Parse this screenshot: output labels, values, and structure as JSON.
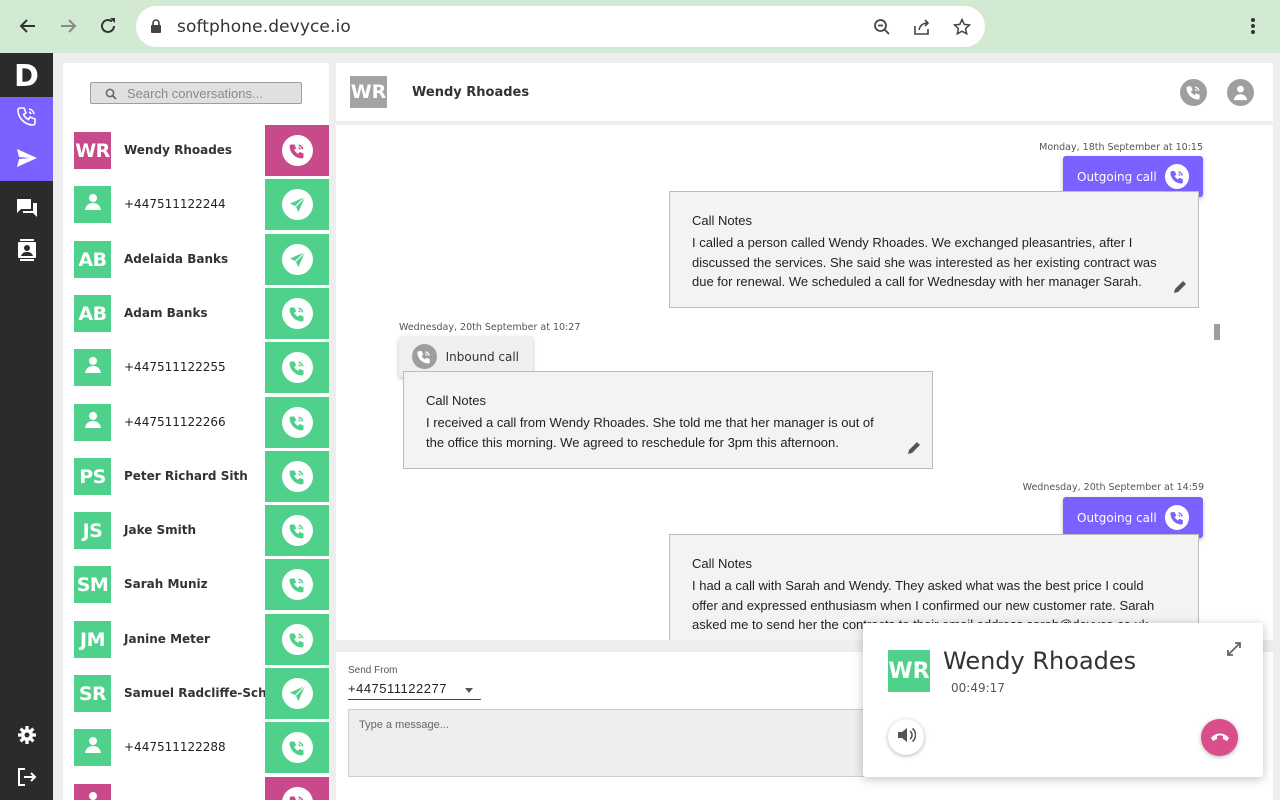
{
  "browser": {
    "url": "softphone.devyce.io",
    "nav_icons": [
      "back-icon",
      "forward-icon",
      "reload-icon"
    ],
    "omnibox_icons": [
      "zoom-icon",
      "share-icon",
      "bookmark-star-icon"
    ],
    "menu_icon": "kebab-menu-icon"
  },
  "rail": {
    "logo": "D",
    "items": [
      {
        "name": "calls",
        "icon": "phone-wifi-icon",
        "active": true
      },
      {
        "name": "send",
        "icon": "send-icon",
        "active": true
      },
      {
        "name": "messages",
        "icon": "chat-icon",
        "active": false
      },
      {
        "name": "contacts",
        "icon": "contact-card-icon",
        "active": false
      }
    ],
    "bottom": [
      {
        "name": "settings",
        "icon": "gear-icon"
      },
      {
        "name": "logout",
        "icon": "logout-icon"
      }
    ]
  },
  "conversations": {
    "search_placeholder": "Search conversations...",
    "items": [
      {
        "initials": "WR",
        "name": "Wendy Rhoades",
        "avatar_color": "#c94a8a",
        "action_color": "#c94a8a",
        "action": "call"
      },
      {
        "initials": "",
        "name": "+447511122244",
        "avatar_color": "#4fd18b",
        "action_color": "#4fd18b",
        "action": "send"
      },
      {
        "initials": "AB",
        "name": "Adelaida Banks",
        "avatar_color": "#4fd18b",
        "action_color": "#4fd18b",
        "action": "send"
      },
      {
        "initials": "AB",
        "name": "Adam Banks",
        "avatar_color": "#4fd18b",
        "action_color": "#4fd18b",
        "action": "call"
      },
      {
        "initials": "",
        "name": "+447511122255",
        "avatar_color": "#4fd18b",
        "action_color": "#4fd18b",
        "action": "call"
      },
      {
        "initials": "",
        "name": "+447511122266",
        "avatar_color": "#4fd18b",
        "action_color": "#4fd18b",
        "action": "call"
      },
      {
        "initials": "PS",
        "name": "Peter Richard Sith",
        "avatar_color": "#4fd18b",
        "action_color": "#4fd18b",
        "action": "call"
      },
      {
        "initials": "JS",
        "name": "Jake Smith",
        "avatar_color": "#4fd18b",
        "action_color": "#4fd18b",
        "action": "call"
      },
      {
        "initials": "SM",
        "name": "Sarah Muniz",
        "avatar_color": "#4fd18b",
        "action_color": "#4fd18b",
        "action": "call"
      },
      {
        "initials": "JM",
        "name": "Janine Meter",
        "avatar_color": "#4fd18b",
        "action_color": "#4fd18b",
        "action": "call"
      },
      {
        "initials": "SR",
        "name": "Samuel Radcliffe-Schw...",
        "avatar_color": "#4fd18b",
        "action_color": "#4fd18b",
        "action": "send"
      },
      {
        "initials": "",
        "name": "+447511122288",
        "avatar_color": "#4fd18b",
        "action_color": "#4fd18b",
        "action": "call"
      },
      {
        "initials": "",
        "name": "",
        "avatar_color": "#c94a8a",
        "action_color": "#c94a8a",
        "action": "call"
      }
    ]
  },
  "chat": {
    "header": {
      "initials": "WR",
      "name": "Wendy Rhoades",
      "icons": [
        "phone-wifi-icon",
        "person-icon"
      ]
    },
    "events": [
      {
        "timestamp": "Monday, 18th September at 10:15",
        "direction": "outgoing",
        "chip_label": "Outgoing call",
        "notes_title": "Call Notes",
        "notes_lines": [
          "I called a person called Wendy Rhoades. We exchanged pleasantries, after I",
          "discussed the services. She said she was interested as her existing contract was",
          "due for renewal. We scheduled a call for Wednesday with her manager Sarah."
        ]
      },
      {
        "timestamp": "Wednesday, 20th September at 10:27",
        "direction": "inbound",
        "chip_label": "Inbound call",
        "notes_title": "Call Notes",
        "notes_lines": [
          "I received a call from Wendy Rhoades. She told me that her manager is out of",
          "the office this morning. We agreed to reschedule for 3pm this afternoon."
        ]
      },
      {
        "timestamp": "Wednesday, 20th September at 14:59",
        "direction": "outgoing",
        "chip_label": "Outgoing call",
        "notes_title": "Call Notes",
        "notes_lines": [
          "I had a call with Sarah and Wendy. They asked what was the best price I could",
          "offer and expressed enthusiasm when I confirmed our new customer rate. Sarah",
          "asked me to send her the contracts to their email address sarah@devyce.co.uk"
        ]
      }
    ]
  },
  "composer": {
    "send_from_label": "Send From",
    "send_from_value": "+447511122277",
    "message_placeholder": "Type a message..."
  },
  "active_call": {
    "initials": "WR",
    "name": "Wendy Rhoades",
    "duration": "00:49:17",
    "avatar_color": "#4fd18b",
    "hangup_color": "#d94f8c"
  },
  "colors": {
    "accent": "#7b61ff",
    "green": "#4fd18b",
    "pink": "#c94a8a",
    "chrome": "#d3ead2"
  }
}
